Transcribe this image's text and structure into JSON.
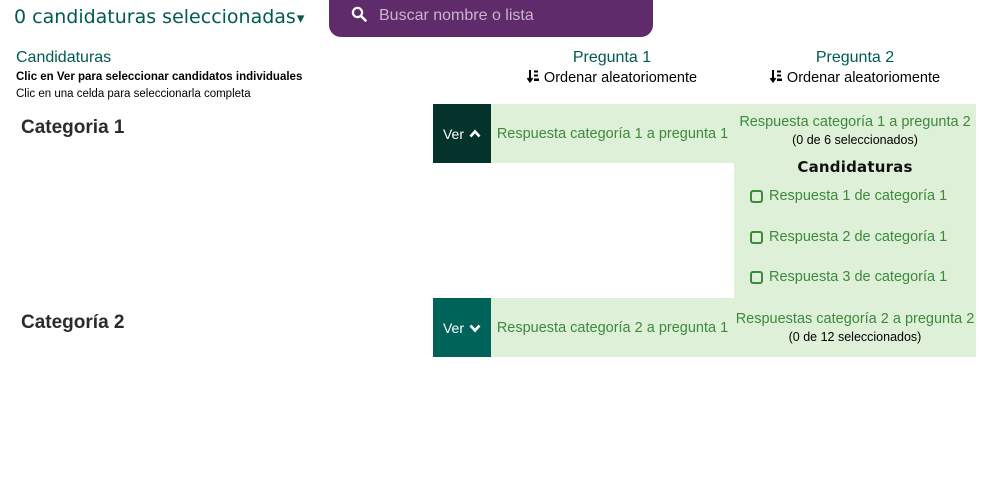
{
  "topbar": {
    "selected_label": "0 candidaturas seleccionadas",
    "caret": "▾",
    "search_placeholder": "Buscar nombre o lista",
    "search_value": ""
  },
  "header": {
    "title": "Candidaturas",
    "hint_bold": "Clic en Ver para seleccionar candidatos individuales",
    "hint": "Clic en una celda para seleccionarla completa",
    "questions": [
      {
        "title": "Pregunta 1",
        "sort_label": "Ordenar aleatoriomente"
      },
      {
        "title": "Pregunta 2",
        "sort_label": "Ordenar aleatoriomente"
      }
    ]
  },
  "categories": [
    {
      "label": "Categoria 1",
      "ver_label": "Ver",
      "expanded": true,
      "q1_answer": "Respuesta categoría 1 a pregunta 1",
      "q2_answer": "Respuesta categoría 1 a pregunta 2",
      "q2_count": "(0 de 6 seleccionados)",
      "candidates_heading": "Candidaturas",
      "candidates": [
        "Respuesta 1 de categoría 1",
        "Respuesta 2 de categoría 1",
        "Respuesta 3 de categoría 1"
      ]
    },
    {
      "label": "Categoría 2",
      "ver_label": "Ver",
      "expanded": false,
      "q1_answer": "Respuesta categoría 2 a pregunta 1",
      "q2_answer": "Respuestas categoría 2 a pregunta 2",
      "q2_count": "(0 de 12 seleccionados)"
    }
  ],
  "colors": {
    "brand_green": "#005b50",
    "ver_expanded_bg": "#04332c",
    "ver_collapsed_bg": "#00635a",
    "search_bg": "#5f2b6a",
    "cell_bg": "#dff0d8",
    "answer_text": "#3c8a3c"
  }
}
